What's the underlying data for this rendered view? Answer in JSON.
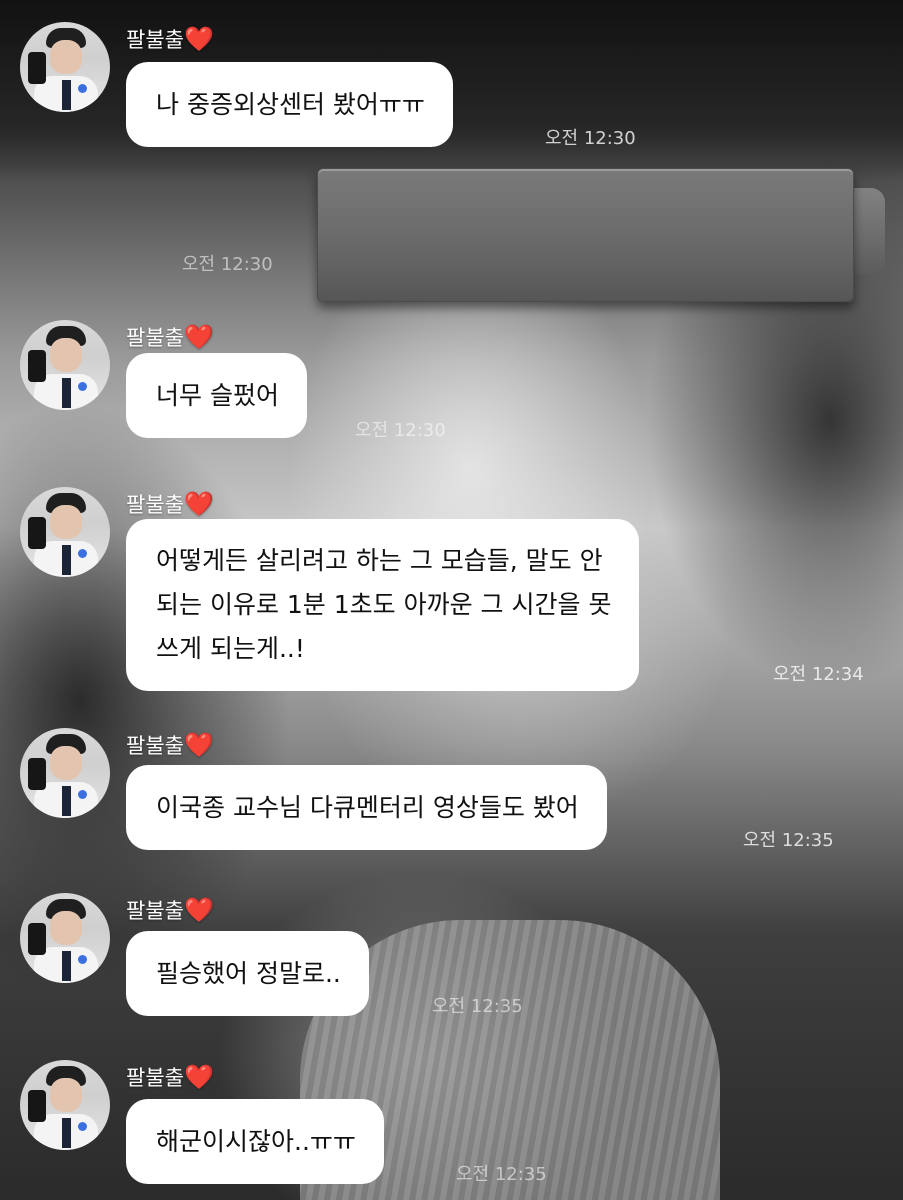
{
  "chat": {
    "standalone_time": "오전 12:30",
    "messages": [
      {
        "sender": "팔불출",
        "heart": "❤️",
        "text": "나 중증외상센터 봤어ㅠㅠ",
        "time": "오전 12:30"
      },
      {
        "sender": "팔불출",
        "heart": "❤️",
        "text": "너무 슬펐어",
        "time": "오전 12:30"
      },
      {
        "sender": "팔불출",
        "heart": "❤️",
        "lines": [
          "어떻게든 살리려고 하는 그 모습들, 말도 안",
          "되는 이유로 1분 1초도 아까운 그 시간을 못",
          "쓰게 되는게..!"
        ],
        "time": "오전 12:34"
      },
      {
        "sender": "팔불출",
        "heart": "❤️",
        "text": "이국종 교수님 다큐멘터리 영상들도 봤어",
        "time": "오전 12:35"
      },
      {
        "sender": "팔불출",
        "heart": "❤️",
        "text": "필승했어 정말로..",
        "time": "오전 12:35"
      },
      {
        "sender": "팔불출",
        "heart": "❤️",
        "text": "해군이시잖아..ㅠㅠ",
        "time": "오전 12:35"
      }
    ]
  },
  "colors": {
    "bubble": "#ffffff",
    "heart": "#e0132a",
    "timestamp": "#ffffff"
  }
}
